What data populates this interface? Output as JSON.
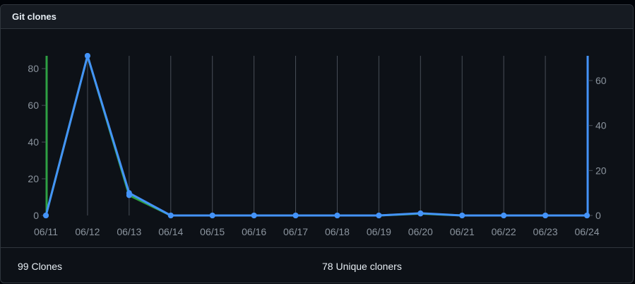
{
  "panel": {
    "title": "Git clones"
  },
  "footer": {
    "clones": "99 Clones",
    "uniques": "78 Unique cloners"
  },
  "colors": {
    "clones": "#2ea043",
    "uniques": "#4493f8",
    "grid": "#484f58",
    "tick_text": "#8b949e"
  },
  "chart_data": {
    "type": "line",
    "categories": [
      "06/11",
      "06/12",
      "06/13",
      "06/14",
      "06/15",
      "06/16",
      "06/17",
      "06/18",
      "06/19",
      "06/20",
      "06/21",
      "06/22",
      "06/23",
      "06/24"
    ],
    "series": [
      {
        "axis": "left",
        "values": [
          0,
          87,
          11,
          0,
          0,
          0,
          0,
          0,
          0,
          1,
          0,
          0,
          0,
          0
        ]
      },
      {
        "axis": "right",
        "values": [
          0,
          71,
          10,
          0,
          0,
          0,
          0,
          0,
          0,
          1,
          0,
          0,
          0,
          0
        ]
      }
    ],
    "y_left": {
      "ticks": [
        "0",
        "20",
        "40",
        "60",
        "80"
      ],
      "lim": [
        0,
        87
      ]
    },
    "y_right": {
      "ticks": [
        "0",
        "20",
        "40",
        "60"
      ],
      "lim": [
        0,
        71
      ]
    },
    "grid": "vertical",
    "legend": "none"
  }
}
